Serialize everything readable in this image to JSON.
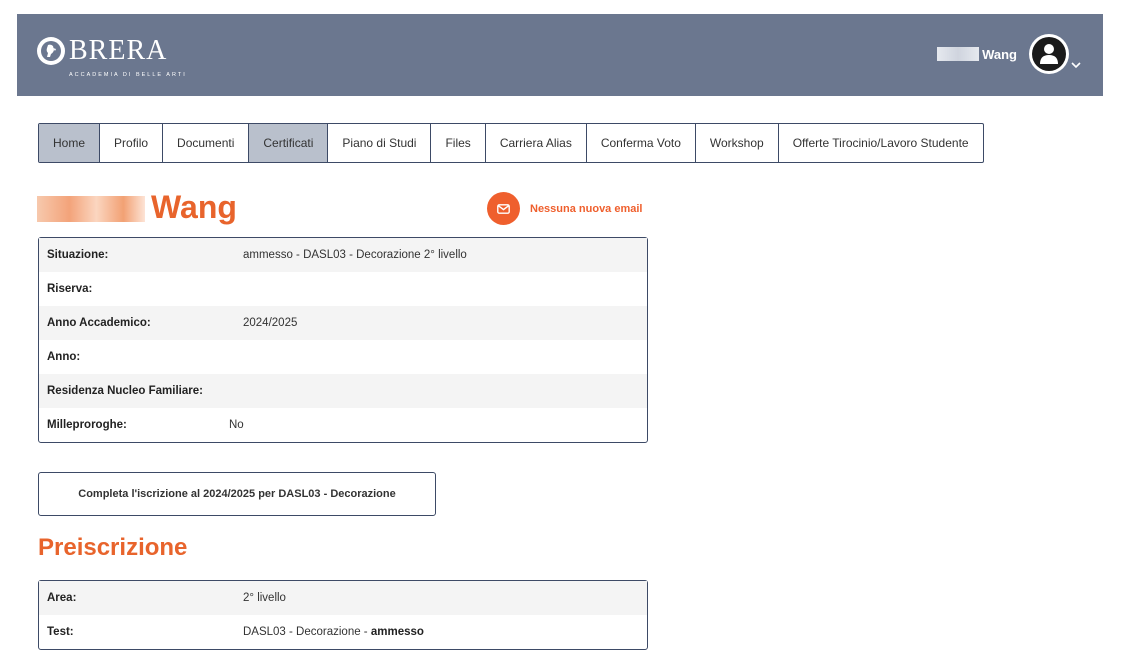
{
  "header": {
    "logo_text": "BRERA",
    "logo_subtitle": "ACCADEMIA DI BELLE ARTI",
    "user_name": "Wang",
    "avatar_icon": "user-circle-icon",
    "menu_icon": "chevron-down-icon"
  },
  "tabs": [
    {
      "label": "Home",
      "active": true
    },
    {
      "label": "Profilo",
      "active": false
    },
    {
      "label": "Documenti",
      "active": false
    },
    {
      "label": "Certificati",
      "active": true
    },
    {
      "label": "Piano di Studi",
      "active": false
    },
    {
      "label": "Files",
      "active": false
    },
    {
      "label": "Carriera Alias",
      "active": false
    },
    {
      "label": "Conferma Voto",
      "active": false
    },
    {
      "label": "Workshop",
      "active": false
    },
    {
      "label": "Offerte Tirocinio/Lavoro Studente",
      "active": false
    }
  ],
  "student": {
    "last_name": "Wang"
  },
  "email": {
    "icon": "envelope-icon",
    "status": "Nessuna nuova email"
  },
  "situazione": {
    "rows": [
      {
        "label": "Situazione:",
        "value": "ammesso - DASL03 - Decorazione 2° livello"
      },
      {
        "label": "Riserva:",
        "value": ""
      },
      {
        "label": "Anno Accademico:",
        "value": "2024/2025"
      },
      {
        "label": "Anno:",
        "value": ""
      },
      {
        "label": "Residenza Nucleo Familiare:",
        "value": ""
      },
      {
        "label": "Milleproroghe:",
        "value": "No"
      }
    ]
  },
  "actions": {
    "complete_enrollment": "Completa l'iscrizione al 2024/2025 per DASL03 - Decorazione"
  },
  "preiscrizione": {
    "title": "Preiscrizione",
    "area_label": "Area:",
    "area_value": "2° livello",
    "test_label": "Test:",
    "test_value": "DASL03 - Decorazione - ",
    "test_status": "ammesso"
  },
  "colors": {
    "header_bg": "#6b778f",
    "accent": "#e8642c",
    "border": "#3d4a66",
    "active_tab": "#b9c0cc"
  }
}
